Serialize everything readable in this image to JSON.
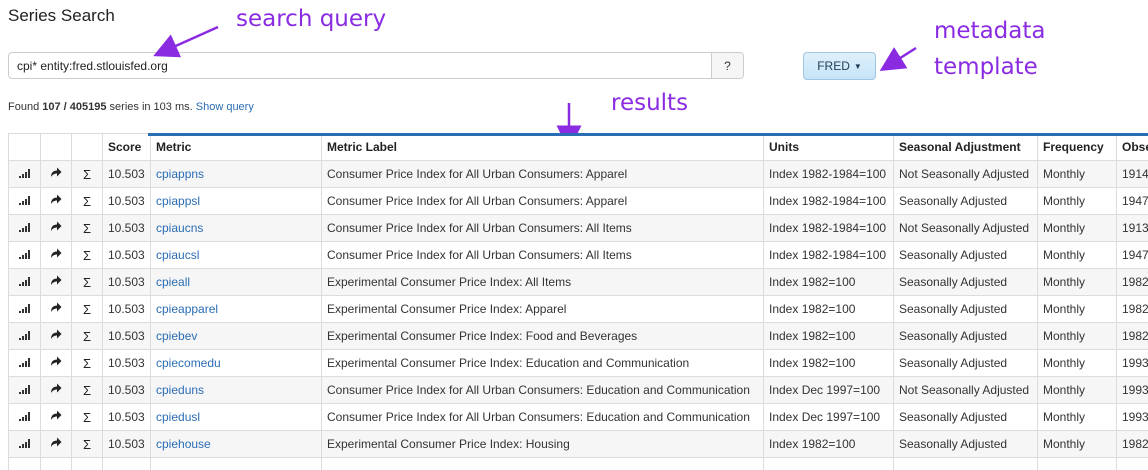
{
  "page": {
    "title": "Series Search"
  },
  "search": {
    "value": "cpi* entity:fred.stlouisfed.org",
    "help_label": "?"
  },
  "template_button": {
    "label": "FRED"
  },
  "annotations": {
    "search_query": "search query",
    "metadata": "metadata",
    "template": "template",
    "results": "results"
  },
  "status": {
    "found_prefix": "Found ",
    "found_count": "107 / 405195",
    "found_suffix": " series in 103 ms. ",
    "show_query": "Show query"
  },
  "table": {
    "headers": [
      "",
      "",
      "",
      "Score",
      "Metric",
      "Metric Label",
      "Units",
      "Seasonal Adjustment",
      "Frequency",
      "Obse"
    ],
    "rows": [
      {
        "score": "10.503",
        "metric": "cpiappns",
        "label": "Consumer Price Index for All Urban Consumers: Apparel",
        "units": "Index 1982-1984=100",
        "seasonal": "Not Seasonally Adjusted",
        "frequency": "Monthly",
        "obs": "1914-"
      },
      {
        "score": "10.503",
        "metric": "cpiappsl",
        "label": "Consumer Price Index for All Urban Consumers: Apparel",
        "units": "Index 1982-1984=100",
        "seasonal": "Seasonally Adjusted",
        "frequency": "Monthly",
        "obs": "1947-"
      },
      {
        "score": "10.503",
        "metric": "cpiaucns",
        "label": "Consumer Price Index for All Urban Consumers: All Items",
        "units": "Index 1982-1984=100",
        "seasonal": "Not Seasonally Adjusted",
        "frequency": "Monthly",
        "obs": "1913-"
      },
      {
        "score": "10.503",
        "metric": "cpiaucsl",
        "label": "Consumer Price Index for All Urban Consumers: All Items",
        "units": "Index 1982-1984=100",
        "seasonal": "Seasonally Adjusted",
        "frequency": "Monthly",
        "obs": "1947-"
      },
      {
        "score": "10.503",
        "metric": "cpieall",
        "label": "Experimental Consumer Price Index: All Items",
        "units": "Index 1982=100",
        "seasonal": "Seasonally Adjusted",
        "frequency": "Monthly",
        "obs": "1982-"
      },
      {
        "score": "10.503",
        "metric": "cpieapparel",
        "label": "Experimental Consumer Price Index: Apparel",
        "units": "Index 1982=100",
        "seasonal": "Seasonally Adjusted",
        "frequency": "Monthly",
        "obs": "1982-"
      },
      {
        "score": "10.503",
        "metric": "cpiebev",
        "label": "Experimental Consumer Price Index: Food and Beverages",
        "units": "Index 1982=100",
        "seasonal": "Seasonally Adjusted",
        "frequency": "Monthly",
        "obs": "1982-"
      },
      {
        "score": "10.503",
        "metric": "cpiecomedu",
        "label": "Experimental Consumer Price Index: Education and Communication",
        "units": "Index 1982=100",
        "seasonal": "Seasonally Adjusted",
        "frequency": "Monthly",
        "obs": "1993-"
      },
      {
        "score": "10.503",
        "metric": "cpieduns",
        "label": "Consumer Price Index for All Urban Consumers: Education and Communication",
        "units": "Index Dec 1997=100",
        "seasonal": "Not Seasonally Adjusted",
        "frequency": "Monthly",
        "obs": "1993-"
      },
      {
        "score": "10.503",
        "metric": "cpiedusl",
        "label": "Consumer Price Index for All Urban Consumers: Education and Communication",
        "units": "Index Dec 1997=100",
        "seasonal": "Seasonally Adjusted",
        "frequency": "Monthly",
        "obs": "1993-"
      },
      {
        "score": "10.503",
        "metric": "cpiehouse",
        "label": "Experimental Consumer Price Index: Housing",
        "units": "Index 1982=100",
        "seasonal": "Seasonally Adjusted",
        "frequency": "Monthly",
        "obs": "1982-"
      },
      {
        "score": "",
        "metric": "",
        "label": "",
        "units": "",
        "seasonal": "",
        "frequency": "",
        "obs": ""
      }
    ]
  },
  "icons": {
    "row_actions": [
      "bar-chart-icon",
      "share-arrow-icon",
      "sigma-icon"
    ]
  },
  "colors": {
    "link": "#2a6db5",
    "annotation": "#8a2be2",
    "table_accent": "#2a6db5",
    "template_button_bg": "#c6e4f7"
  }
}
